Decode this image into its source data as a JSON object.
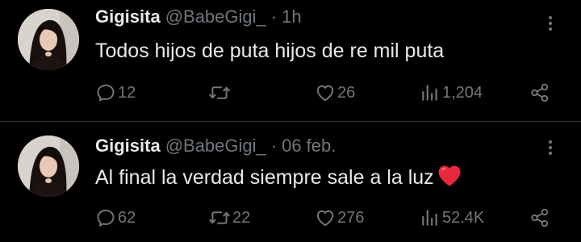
{
  "colors": {
    "background": "#000000",
    "text_primary": "#e7e9ea",
    "text_secondary": "#71767b",
    "divider": "#2f3336",
    "emoji_heart": "#e8283c"
  },
  "tweets": [
    {
      "display_name": "Gigisita",
      "handle": "@BabeGigi_",
      "separator": "·",
      "time": "1h",
      "text": "Todos hijos de puta hijos de re mil puta",
      "emoji": "",
      "reply_count": "12",
      "repost_count": "",
      "like_count": "26",
      "view_count": "1,204",
      "icons": [
        "reply-icon",
        "repost-icon",
        "like-icon",
        "views-icon",
        "share-icon",
        "more-icon"
      ]
    },
    {
      "display_name": "Gigisita",
      "handle": "@BabeGigi_",
      "separator": "·",
      "time": "06 feb.",
      "text": "Al final la verdad siempre sale a la luz",
      "emoji": "red-heart",
      "reply_count": "62",
      "repost_count": "22",
      "like_count": "276",
      "view_count": "52.4K",
      "icons": [
        "reply-icon",
        "repost-icon",
        "like-icon",
        "views-icon",
        "share-icon",
        "more-icon"
      ]
    }
  ]
}
